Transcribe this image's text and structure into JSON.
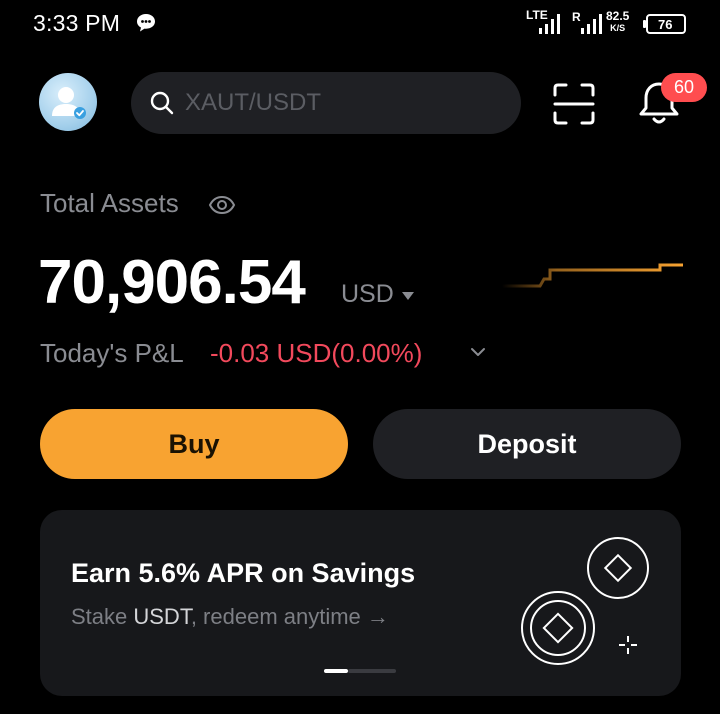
{
  "status_bar": {
    "time": "3:33 PM",
    "network_1": "LTE",
    "network_2": "R",
    "speed_value": "82.5",
    "speed_unit": "K/S",
    "battery": "76"
  },
  "header": {
    "search_placeholder": "XAUT/USDT",
    "notification_count": "60",
    "icons": [
      "avatar",
      "search-icon",
      "scan-icon",
      "bell-icon"
    ]
  },
  "assets": {
    "label": "Total Assets",
    "amount": "70,906.54",
    "currency": "USD",
    "pnl_label": "Today's P&L",
    "pnl_value": "-0.03 USD(0.00%)",
    "pnl_color": "#f2495c",
    "sparkline_color": "#f8a331"
  },
  "actions": {
    "buy_label": "Buy",
    "deposit_label": "Deposit",
    "buy_color": "#f8a331"
  },
  "promo": {
    "title": "Earn 5.6% APR on Savings",
    "sub_prefix": "Stake ",
    "sub_highlight": "USDT",
    "sub_suffix": ", redeem anytime →",
    "pager_pages": 2,
    "pager_active": 1
  }
}
